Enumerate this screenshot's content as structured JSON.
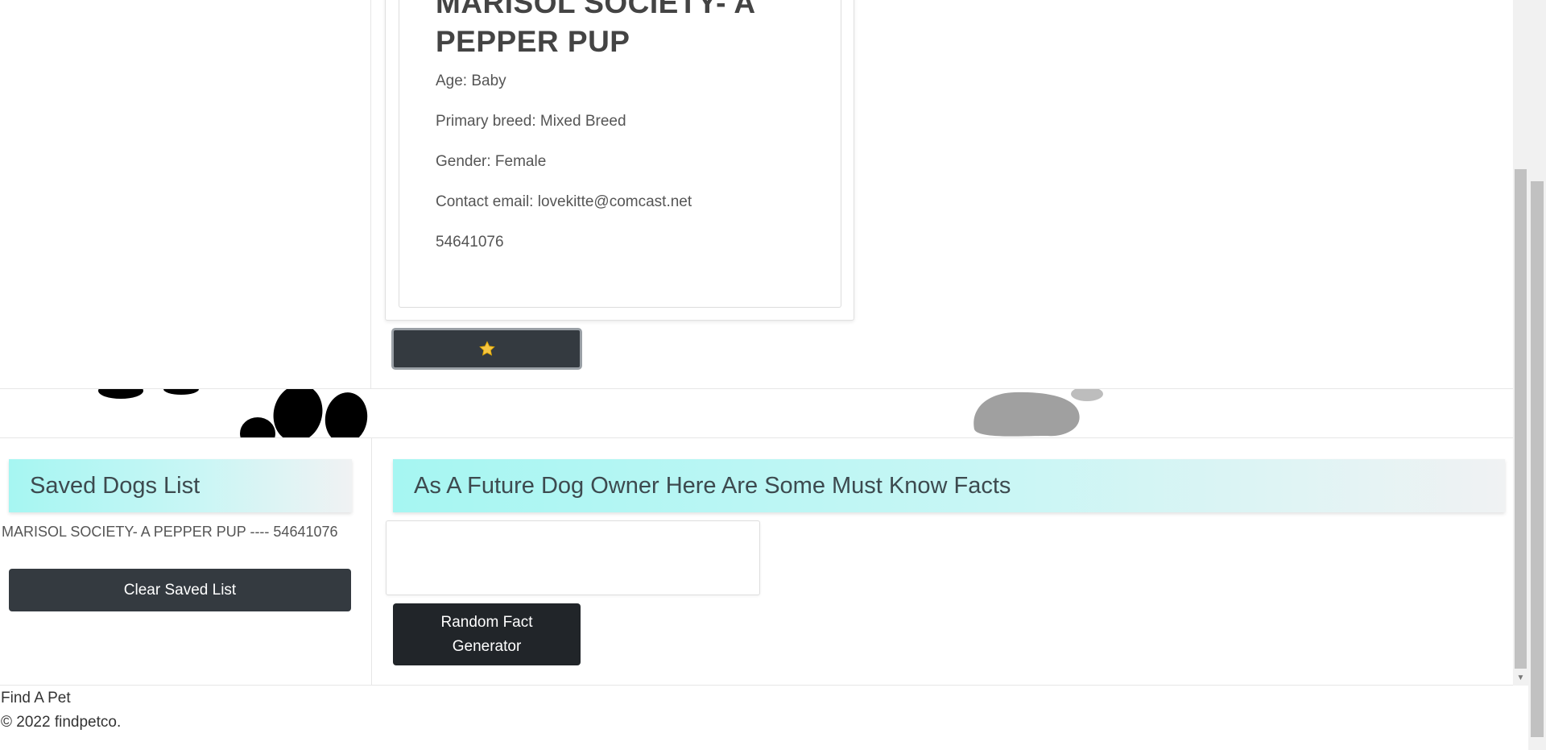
{
  "dog_card": {
    "name": "MARISOL SOCIETY- A PEPPER PUP",
    "age": "Age: Baby",
    "breed": "Primary breed: Mixed Breed",
    "gender": "Gender: Female",
    "email": "Contact email: lovekitte@comcast.net",
    "id": "54641076"
  },
  "favorite_button": {
    "icon": "star-icon",
    "icon_color": "#f5c542"
  },
  "saved_list": {
    "title": "Saved Dogs List",
    "entries": [
      "MARISOL SOCIETY- A PEPPER PUP ---- 54641076"
    ],
    "clear_label": "Clear Saved List"
  },
  "facts": {
    "title": "As A Future Dog Owner Here Are Some Must Know Facts",
    "fact_text": "",
    "button_label": "Random Fact Generator"
  },
  "footer": {
    "brand": "Find A Pet",
    "copyright": "© 2022 findpetco."
  },
  "colors": {
    "dark_button": "#343a40",
    "header_gradient_start": "#a6f6f2",
    "header_gradient_end": "#f0f2f3"
  }
}
